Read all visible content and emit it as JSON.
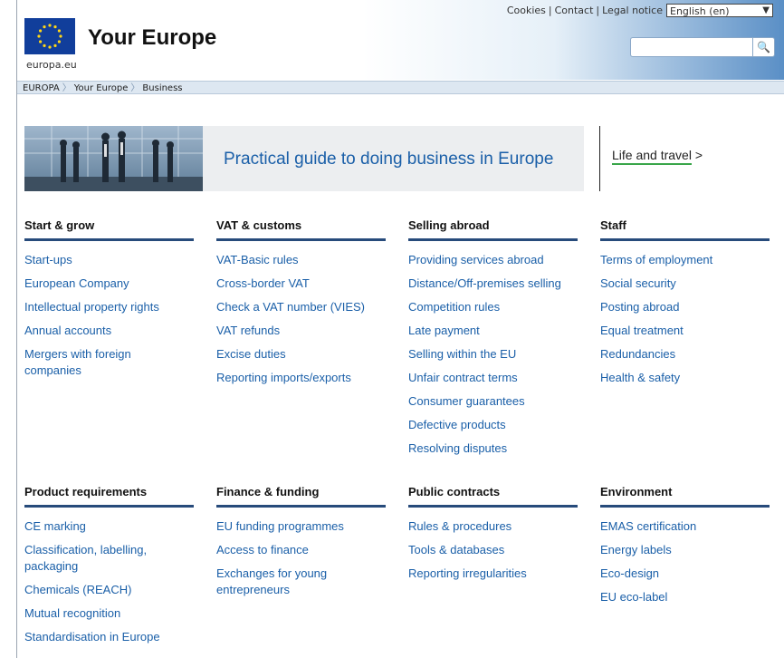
{
  "utility": {
    "cookies": "Cookies",
    "contact": "Contact",
    "legal": "Legal notice",
    "language": "English (en)"
  },
  "logo": {
    "caption": "europa.eu"
  },
  "site_title": "Your Europe",
  "search": {
    "placeholder": ""
  },
  "breadcrumb": [
    "EUROPA",
    "Your Europe",
    "Business"
  ],
  "banner": {
    "text": "Practical guide to doing business in Europe"
  },
  "side_link": {
    "label": "Life and travel",
    "arrow": ">"
  },
  "sections": [
    {
      "title": "Start & grow",
      "links": [
        "Start-ups",
        "European Company",
        "Intellectual property rights",
        "Annual accounts",
        "Mergers with foreign companies"
      ]
    },
    {
      "title": "VAT & customs",
      "links": [
        "VAT-Basic rules",
        "Cross-border VAT",
        "Check a VAT number (VIES)",
        "VAT refunds",
        "Excise duties",
        "Reporting imports/exports"
      ]
    },
    {
      "title": "Selling abroad",
      "links": [
        "Providing services abroad",
        "Distance/Off-premises selling",
        "Competition rules",
        "Late payment",
        "Selling within the EU",
        "Unfair contract terms",
        "Consumer guarantees",
        "Defective products",
        "Resolving disputes"
      ]
    },
    {
      "title": "Staff",
      "links": [
        "Terms of employment",
        "Social security",
        "Posting abroad",
        "Equal treatment",
        "Redundancies",
        "Health & safety"
      ]
    },
    {
      "title": "Product requirements",
      "links": [
        "CE marking",
        "Classification, labelling, packaging",
        "Chemicals (REACH)",
        "Mutual recognition",
        "Standardisation in Europe"
      ]
    },
    {
      "title": "Finance & funding",
      "links": [
        "EU funding programmes",
        "Access to finance",
        "Exchanges for young entrepreneurs"
      ]
    },
    {
      "title": "Public contracts",
      "links": [
        "Rules & procedures",
        "Tools & databases",
        "Reporting irregularities"
      ]
    },
    {
      "title": "Environment",
      "links": [
        "EMAS certification",
        "Energy labels",
        "Eco-design",
        "EU eco-label"
      ]
    }
  ]
}
